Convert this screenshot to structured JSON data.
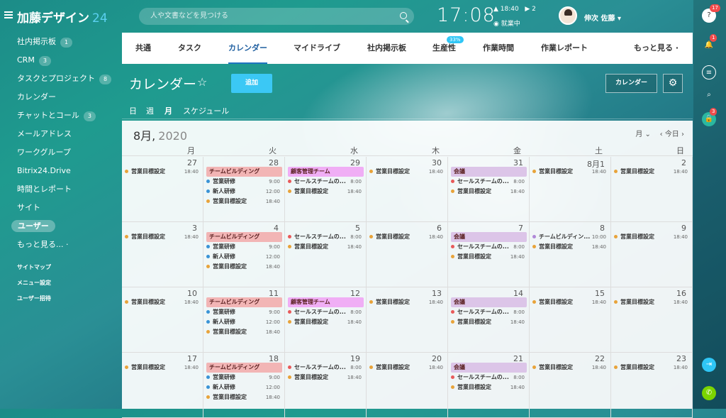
{
  "header": {
    "logo_text": "加藤デザイン",
    "logo_num": "24",
    "search_placeholder": "人や文書などを見つける",
    "clock": "17:08",
    "status_time": "▲ 18:40",
    "status_flag": "▶ 2",
    "status_work": "◉ 就業中",
    "user": "伸次 佐藤"
  },
  "sidebar": {
    "items": [
      {
        "label": "社内掲示板",
        "count": "1"
      },
      {
        "label": "CRM",
        "count": "3"
      },
      {
        "label": "タスクとプロジェクト",
        "count": "8"
      },
      {
        "label": "カレンダー",
        "count": ""
      },
      {
        "label": "チャットとコール",
        "count": "3"
      },
      {
        "label": "メールアドレス",
        "count": ""
      },
      {
        "label": "ワークグループ",
        "count": ""
      },
      {
        "label": "Bitrix24.Drive",
        "count": ""
      },
      {
        "label": "時間とレポート",
        "count": ""
      },
      {
        "label": "サイト",
        "count": ""
      },
      {
        "label": "ユーザー",
        "count": ""
      },
      {
        "label": "もっと見る... ·",
        "count": ""
      }
    ],
    "small": [
      "サイトマップ",
      "メニュー設定",
      "ユーザー招待"
    ]
  },
  "tabs": [
    "共通",
    "タスク",
    "カレンダー",
    "マイドライブ",
    "社内掲示板",
    "生産性",
    "作業時間",
    "作業レポート",
    "もっと見る ·"
  ],
  "tab_badge": "33%",
  "page": {
    "title": "カレンダー",
    "add": "追加",
    "calendar_btn": "カレンダー"
  },
  "views": [
    "日",
    "週",
    "月",
    "スケジュール"
  ],
  "calendar": {
    "month": "8月,",
    "year": "2020",
    "nav_month": "月",
    "today": "今日",
    "daynames": [
      "月",
      "火",
      "水",
      "木",
      "金",
      "土",
      "日"
    ],
    "weeks": [
      [
        "27",
        "28",
        "29",
        "30",
        "31",
        "8月1",
        "2"
      ],
      [
        "3",
        "4",
        "5",
        "6",
        "7",
        "8",
        "9"
      ],
      [
        "10",
        "11",
        "12",
        "13",
        "14",
        "15",
        "16"
      ],
      [
        "17",
        "18",
        "19",
        "20",
        "21",
        "22",
        "23"
      ]
    ],
    "events": {
      "goal": "営業目標設定",
      "goal_time": "18:40",
      "team": "チームビルディング",
      "training1": "営業研修",
      "training1_time": "9:00",
      "training2": "新人研修",
      "training2_time": "12:00",
      "client": "顧客管理チーム",
      "sales": "セールスチームの...",
      "sales_time": "8:00",
      "meeting": "会議",
      "team_short": "チームビルディン...",
      "team_time": "10:00"
    },
    "colors": {
      "goal": "#e8a33a",
      "team_bg": "#f2b5b5",
      "blue": "#3a93d6",
      "client_bg": "#f0aef5",
      "sales": "#e85a5a",
      "meet_bg": "#dcc5e8",
      "team_dot": "#b088d8"
    }
  }
}
